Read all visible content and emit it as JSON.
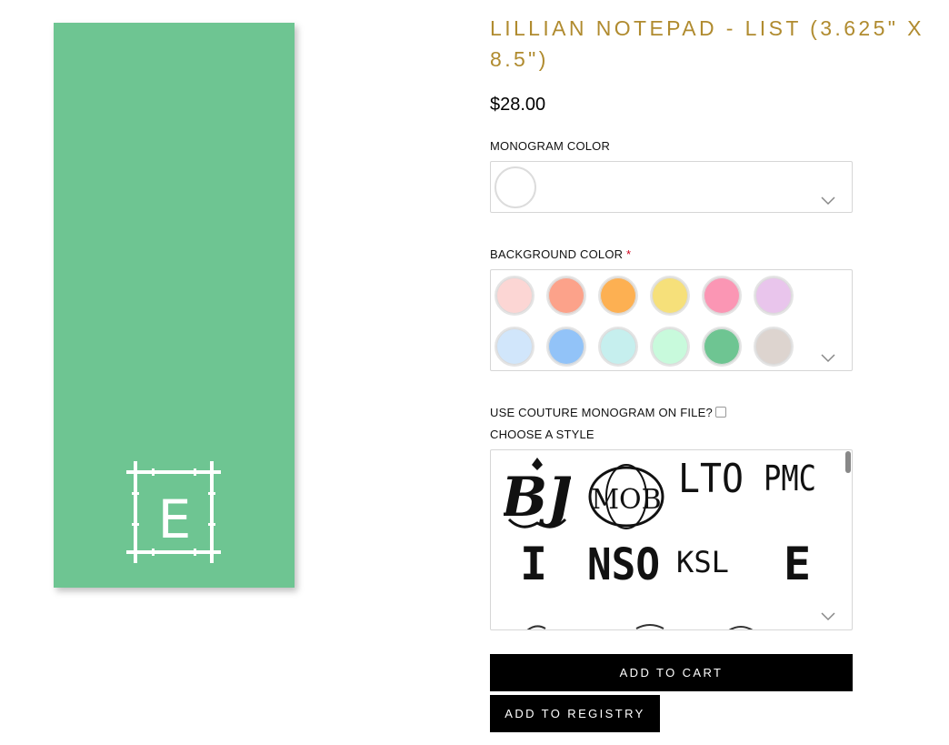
{
  "product": {
    "title": "LILLIAN NOTEPAD - LIST (3.625\" X 8.5\")",
    "price": "$28.00",
    "preview_monogram_letter": "E",
    "preview_background": "#6ec592"
  },
  "monogram_color": {
    "label": "MONOGRAM COLOR",
    "selected": "#ffffff"
  },
  "background_color": {
    "label": "BACKGROUND COLOR",
    "required_mark": "*",
    "swatches": [
      "#fcd6d4",
      "#fca28a",
      "#fdb052",
      "#f6e07a",
      "#fb96b4",
      "#e9c5ec",
      "#d1e6fb",
      "#92c3f8",
      "#c6efee",
      "#c8fadc",
      "#6ec592",
      "#ddd4cf"
    ]
  },
  "couture": {
    "label": "USE COUTURE MONOGRAM ON FILE?"
  },
  "style": {
    "label": "CHOOSE A STYLE",
    "items": [
      "BJ",
      "MOB",
      "LTO",
      "PMC",
      "I",
      "NSO",
      "KSL",
      "E"
    ]
  },
  "buttons": {
    "add_to_cart": "ADD TO CART",
    "add_to_registry": "ADD TO REGISTRY"
  }
}
